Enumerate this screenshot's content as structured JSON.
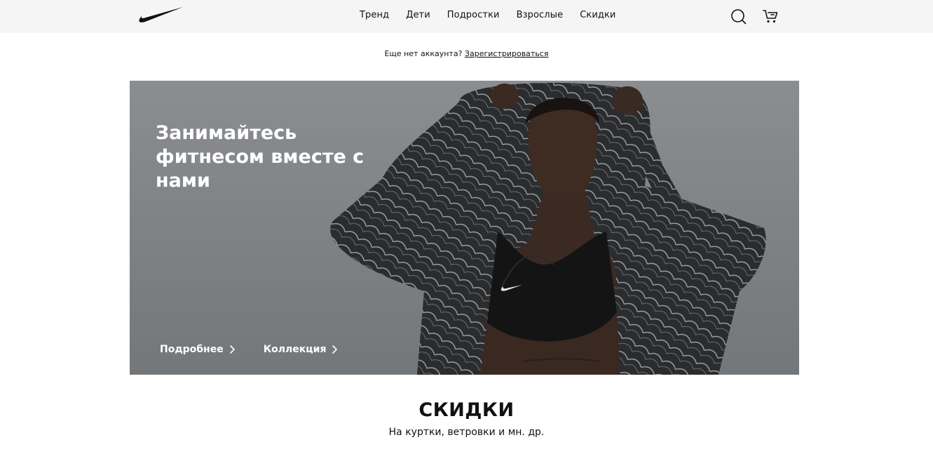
{
  "brand": {
    "logo": "nike-swoosh-logo"
  },
  "nav": {
    "items": [
      "Тренд",
      "Дети",
      "Подростки",
      "Взрослые",
      "Скидки"
    ]
  },
  "header_icons": [
    "search-icon",
    "cart-icon"
  ],
  "signup": {
    "prompt": "Еще нет аккаунта?",
    "link": "Зарегистрироваться"
  },
  "hero": {
    "title": "Занимайтесь фитнесом вместе с нами",
    "links": [
      "Подробнее",
      "Коллекция"
    ],
    "image": "woman in patterned hooded jacket and black sports bra"
  },
  "sale": {
    "title": "СКИДКИ",
    "subtitle": "На куртки, ветровки и мн. др."
  },
  "colors": {
    "topbar_bg": "#f5f5f5",
    "hero_bg": "#7d7f82",
    "text": "#111111",
    "hero_text": "#ffffff"
  }
}
